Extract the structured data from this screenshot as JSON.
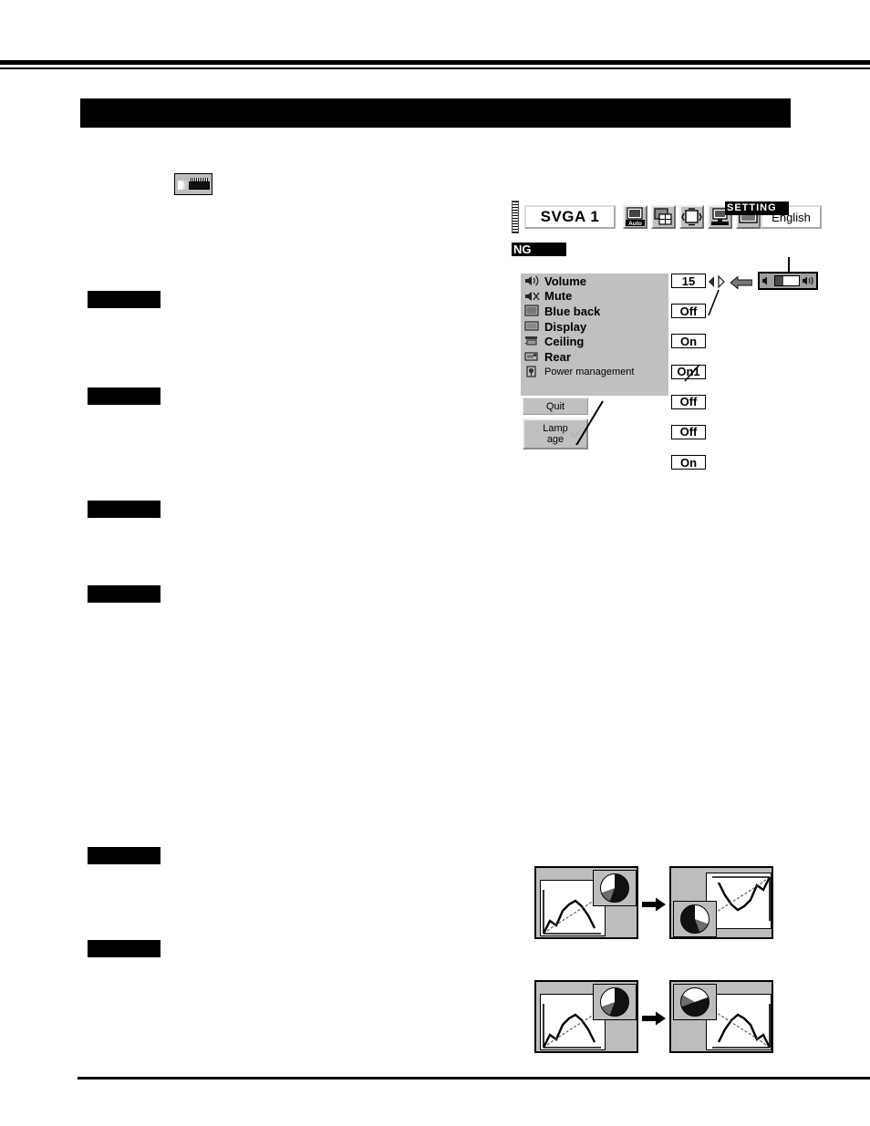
{
  "page": {
    "title_bar_redacted": true,
    "left_labels": [
      {
        "name": "volume-label",
        "redacted": true
      },
      {
        "name": "mute-label",
        "redacted": true
      },
      {
        "name": "blue-back-label",
        "redacted": true
      },
      {
        "name": "display-label",
        "redacted": true
      },
      {
        "name": "ceiling-label",
        "redacted": true
      },
      {
        "name": "rear-label",
        "redacted": true
      }
    ]
  },
  "inline_icon": {
    "name": "setting-projector-icon"
  },
  "osd": {
    "source_field": {
      "value": "SVGA 1"
    },
    "language_field": {
      "value": "English"
    },
    "menu_tag": "SETTING",
    "partial_tag": "NG",
    "icons": [
      {
        "name": "auto-image-icon",
        "label": "Auto",
        "selected": false
      },
      {
        "name": "image-adjust-icon",
        "label": "",
        "selected": false
      },
      {
        "name": "image-select-icon",
        "label": "",
        "selected": false
      },
      {
        "name": "pc-adjust-icon",
        "label": "",
        "selected": false
      },
      {
        "name": "screen-icon",
        "label": "",
        "selected": false
      },
      {
        "name": "setting-icon",
        "label": "",
        "selected": true
      }
    ],
    "rows": [
      {
        "icon": "volume-icon",
        "label": "Volume",
        "value": "15"
      },
      {
        "icon": "mute-icon",
        "label": "Mute",
        "value": "Off"
      },
      {
        "icon": "blueback-icon",
        "label": "Blue back",
        "value": "On"
      },
      {
        "icon": "display-icon",
        "label": "Display",
        "value": "On1"
      },
      {
        "icon": "ceiling-icon",
        "label": "Ceiling",
        "value": "Off"
      },
      {
        "icon": "rear-icon",
        "label": "Rear",
        "value": "Off"
      },
      {
        "icon": "power-icon",
        "label": "Power management",
        "value": "On"
      }
    ],
    "quit_button": "Quit",
    "lamp_button_line1": "Lamp",
    "lamp_button_line2": "age",
    "volume_slider": {
      "name": "volume-slider",
      "fill_percent": 34
    }
  },
  "illustrations": [
    {
      "name": "ceiling-projection-illustration"
    },
    {
      "name": "rear-projection-illustration"
    }
  ],
  "colors": {
    "ink": "#000000",
    "panel_gray": "#c0c0c0",
    "illus_gray": "#bdbdbd",
    "white": "#ffffff"
  }
}
